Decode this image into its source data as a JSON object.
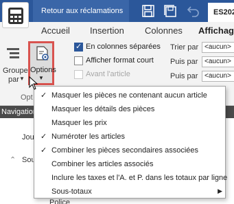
{
  "titlebar": {
    "back_label": "Retour aux réclamations",
    "doc_tab": "ES202"
  },
  "tabs": [
    {
      "label": "Accueil"
    },
    {
      "label": "Insertion"
    },
    {
      "label": "Colonnes"
    },
    {
      "label": "Affichag"
    }
  ],
  "ribbon": {
    "group_label": "Grouper",
    "group_label2": "par",
    "options_label": "Options",
    "group_name_partial": "Opt",
    "checkboxes": [
      {
        "label": "En colonnes séparées",
        "checked": true,
        "enabled": true
      },
      {
        "label": "Afficher format court",
        "checked": false,
        "enabled": true
      },
      {
        "label": "Avant l'article",
        "checked": false,
        "enabled": false
      }
    ],
    "sort": [
      {
        "label": "Trier par",
        "value": "<aucun>"
      },
      {
        "label": "Puis par",
        "value": "<aucun>"
      },
      {
        "label": "Puis par",
        "value": "<aucun>"
      }
    ]
  },
  "navbar": {
    "label": "Navigation"
  },
  "tree": [
    {
      "label": "Jou"
    },
    {
      "label": "Sou"
    },
    {
      "label": "Police"
    }
  ],
  "menu": [
    {
      "label": "Masquer les pièces ne contenant aucun article",
      "checked": true
    },
    {
      "label": "Masquer les détails des pièces",
      "checked": false
    },
    {
      "label": "Masquer les prix",
      "checked": false
    },
    {
      "label": "Numéroter les articles",
      "checked": true
    },
    {
      "label": "Combiner les pièces secondaires associées",
      "checked": true
    },
    {
      "label": "Combiner les articles associés",
      "checked": false
    },
    {
      "label": "Inclure les taxes et l'A. et P. dans les totaux par ligne",
      "checked": false
    },
    {
      "label": "Sous-totaux",
      "checked": false,
      "submenu": true
    }
  ],
  "colors": {
    "titlebar": "#2b579a",
    "ribbon": "#f3f3f3",
    "highlight": "#d9534f"
  }
}
